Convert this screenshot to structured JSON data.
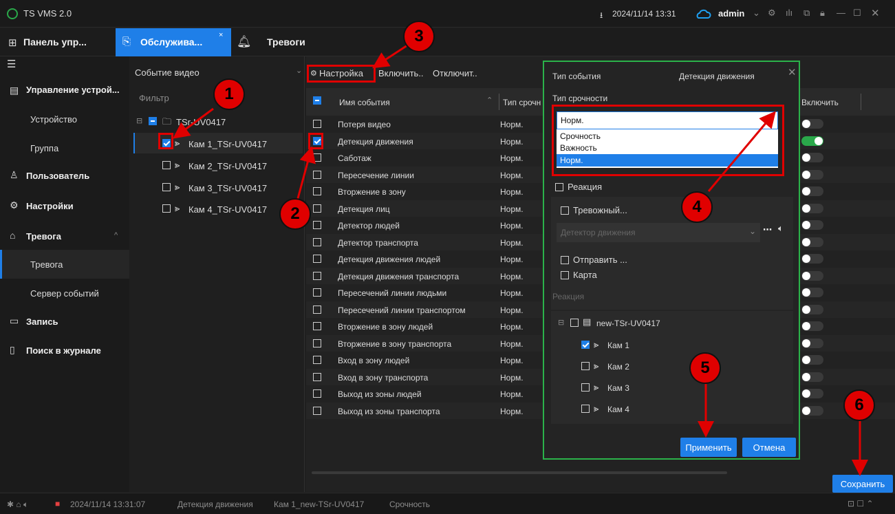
{
  "app": {
    "title": "TS VMS 2.0",
    "datetime": "2024/11/14 13:31",
    "user": "admin"
  },
  "tabs": {
    "panel": "Панель упр...",
    "service": "Обслужива...",
    "alarms": "Тревоги"
  },
  "sidebar": {
    "items": [
      {
        "label": "Управление устрой...",
        "level": 1
      },
      {
        "label": "Устройство",
        "level": 2
      },
      {
        "label": "Группа",
        "level": 2
      },
      {
        "label": "Пользователь",
        "level": 1
      },
      {
        "label": "Настройки",
        "level": 1
      },
      {
        "label": "Тревога",
        "level": 1
      },
      {
        "label": "Тревога",
        "level": 2,
        "active": true
      },
      {
        "label": "Сервер событий",
        "level": 2
      },
      {
        "label": "Запись",
        "level": 1
      },
      {
        "label": "Поиск в журнале",
        "level": 1
      }
    ]
  },
  "devices": {
    "type_select": "Событие видео",
    "filter_placeholder": "Фильтр",
    "root": "TSr-UV0417",
    "cams": [
      {
        "label": "Кам 1_TSr-UV0417",
        "checked": true
      },
      {
        "label": "Кам 2_TSr-UV0417",
        "checked": false
      },
      {
        "label": "Кам 3_TSr-UV0417",
        "checked": false
      },
      {
        "label": "Кам 4_TSr-UV0417",
        "checked": false
      }
    ]
  },
  "toolbar": {
    "settings": "Настройка",
    "enable": "Включить..",
    "disable": "Отключит.."
  },
  "table": {
    "col_name": "Имя события",
    "col_urgency": "Тип срочн",
    "col_enable": "Включить",
    "rows": [
      {
        "name": "Потеря видео",
        "urgency": "Норм.",
        "checked": false,
        "on": false
      },
      {
        "name": "Детекция движения",
        "urgency": "Норм.",
        "checked": true,
        "on": true
      },
      {
        "name": "Саботаж",
        "urgency": "Норм.",
        "checked": false,
        "on": false
      },
      {
        "name": "Пересечение линии",
        "urgency": "Норм.",
        "checked": false,
        "on": false
      },
      {
        "name": "Вторжение в зону",
        "urgency": "Норм.",
        "checked": false,
        "on": false
      },
      {
        "name": "Детекция лиц",
        "urgency": "Норм.",
        "checked": false,
        "on": false
      },
      {
        "name": "Детектор людей",
        "urgency": "Норм.",
        "checked": false,
        "on": false
      },
      {
        "name": "Детектор транспорта",
        "urgency": "Норм.",
        "checked": false,
        "on": false
      },
      {
        "name": "Детекция движения людей",
        "urgency": "Норм.",
        "checked": false,
        "on": false
      },
      {
        "name": "Детекция движения транспорта",
        "urgency": "Норм.",
        "checked": false,
        "on": false
      },
      {
        "name": "Пересечений линии людьми",
        "urgency": "Норм.",
        "checked": false,
        "on": false
      },
      {
        "name": "Пересечений линии транспортом",
        "urgency": "Норм.",
        "checked": false,
        "on": false
      },
      {
        "name": "Вторжение в зону людей",
        "urgency": "Норм.",
        "checked": false,
        "on": false
      },
      {
        "name": "Вторжение в зону транспорта",
        "urgency": "Норм.",
        "checked": false,
        "on": false
      },
      {
        "name": "Вход в зону людей",
        "urgency": "Норм.",
        "checked": false,
        "on": false
      },
      {
        "name": "Вход в зону транспорта",
        "urgency": "Норм.",
        "checked": false,
        "on": false
      },
      {
        "name": "Выход из зоны людей",
        "urgency": "Норм.",
        "checked": false,
        "on": false
      },
      {
        "name": "Выход из зоны транспорта",
        "urgency": "Норм.",
        "checked": false,
        "on": false
      }
    ]
  },
  "dialog": {
    "event_type_label": "Тип события",
    "event_type_value": "Детекция движения",
    "urgency_label": "Тип срочности",
    "urgency_value": "Норм.",
    "urgency_options": [
      "Срочность",
      "Важность",
      "Норм."
    ],
    "reaction": "Реакция",
    "alarm": "Тревожный...",
    "sound_placeholder": "Детектор движения",
    "send": "Отправить ...",
    "map": "Карта",
    "reaction_section": "Реакция",
    "tree_root": "new-TSr-UV0417",
    "tree_cams": [
      {
        "label": "Кам 1",
        "checked": true
      },
      {
        "label": "Кам 2",
        "checked": false
      },
      {
        "label": "Кам 3",
        "checked": false
      },
      {
        "label": "Кам 4",
        "checked": false
      }
    ],
    "apply": "Применить",
    "cancel": "Отмена"
  },
  "save": "Сохранить",
  "status": {
    "time": "2024/11/14 13:31:07",
    "event": "Детекция движения",
    "camera": "Кам 1_new-TSr-UV0417",
    "urgency": "Срочность"
  },
  "markers": [
    "1",
    "2",
    "3",
    "4",
    "5",
    "6"
  ],
  "colors": {
    "accent": "#1f7fe8",
    "annotation": "#e00000",
    "dialog_border": "#2bb34a",
    "toggle_on": "#2aa84a"
  }
}
